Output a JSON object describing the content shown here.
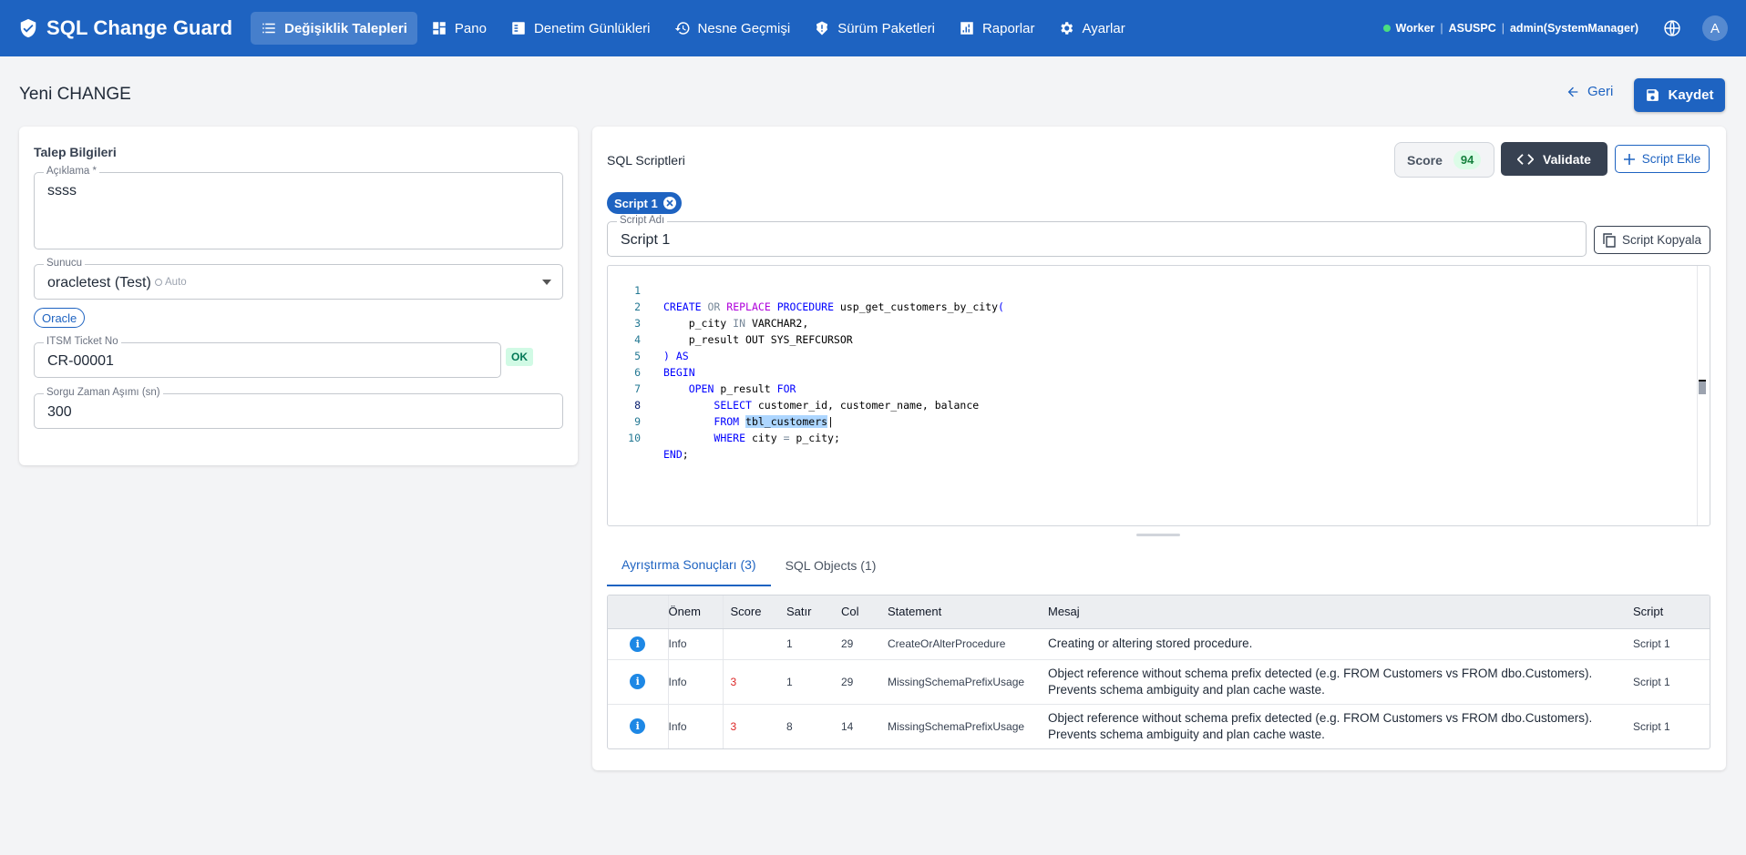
{
  "app": {
    "title": "SQL Change Guard"
  },
  "nav": {
    "items": [
      {
        "label": "Değişiklik Talepleri",
        "icon": "list-icon",
        "active": true
      },
      {
        "label": "Pano",
        "icon": "dashboard-icon"
      },
      {
        "label": "Denetim Günlükleri",
        "icon": "audit-log-icon"
      },
      {
        "label": "Nesne Geçmişi",
        "icon": "history-icon"
      },
      {
        "label": "Sürüm Paketleri",
        "icon": "package-icon"
      },
      {
        "label": "Raporlar",
        "icon": "bar-chart-icon"
      },
      {
        "label": "Ayarlar",
        "icon": "gear-icon"
      }
    ]
  },
  "topright": {
    "worker_label": "Worker",
    "host": "ASUSPC",
    "user": "admin(SystemManager)",
    "avatar_letter": "A",
    "worker_status_color": "#4ade80"
  },
  "page": {
    "title": "Yeni CHANGE",
    "back_label": "Geri",
    "save_label": "Kaydet"
  },
  "left": {
    "section_title": "Talep Bilgileri",
    "description": {
      "label": "Açıklama *",
      "value": "ssss"
    },
    "server": {
      "label": "Sunucu",
      "value": "oracletest (Test)",
      "auto_label": "Auto"
    },
    "db_chip": "Oracle",
    "ticket": {
      "label": "ITSM Ticket No",
      "value": "CR-00001",
      "status": "OK"
    },
    "timeout": {
      "label": "Sorgu Zaman Aşımı (sn)",
      "value": "300"
    }
  },
  "right": {
    "section_title": "SQL Scriptleri",
    "score_label": "Score",
    "score_value": "94",
    "validate_label": "Validate",
    "add_script_label": "Script Ekle",
    "script_tab_label": "Script 1",
    "script_name": {
      "label": "Script Adı",
      "value": "Script 1"
    },
    "copy_label": "Script Kopyala"
  },
  "editor": {
    "current_line": 8,
    "lines": [
      "CREATE OR REPLACE PROCEDURE usp_get_customers_by_city(",
      "    p_city IN VARCHAR2,",
      "    p_result OUT SYS_REFCURSOR",
      ") AS",
      "BEGIN",
      "    OPEN p_result FOR",
      "        SELECT customer_id, customer_name, balance",
      "        FROM tbl_customers",
      "        WHERE city = p_city;",
      "END;"
    ]
  },
  "tabs": [
    {
      "label": "Ayrıştırma Sonuçları (3)",
      "active": true
    },
    {
      "label": "SQL Objects (1)",
      "active": false
    }
  ],
  "results": {
    "columns": [
      "",
      "Önem",
      "Score",
      "Satır",
      "Col",
      "Statement",
      "Mesaj",
      "Script"
    ],
    "rows": [
      {
        "icon": "info-icon",
        "severity": "Info",
        "score": "",
        "line": "1",
        "col": "29",
        "statement": "CreateOrAlterProcedure",
        "message": "Creating or altering stored procedure.",
        "script": "Script 1"
      },
      {
        "icon": "info-icon",
        "severity": "Info",
        "score": "3",
        "line": "1",
        "col": "29",
        "statement": "MissingSchemaPrefixUsage",
        "message": "Object reference without schema prefix detected (e.g. FROM Customers vs FROM dbo.Customers). Prevents schema ambiguity and plan cache waste.",
        "script": "Script 1"
      },
      {
        "icon": "info-icon",
        "severity": "Info",
        "score": "3",
        "line": "8",
        "col": "14",
        "statement": "MissingSchemaPrefixUsage",
        "message": "Object reference without schema prefix detected (e.g. FROM Customers vs FROM dbo.Customers). Prevents schema ambiguity and plan cache waste.",
        "script": "Script 1"
      }
    ]
  },
  "colors": {
    "primary": "#1e63c1",
    "dark_button": "#374151",
    "score_badge_bg": "#dcfce7",
    "score_badge_fg": "#15803d",
    "warning_red": "#dc2626"
  }
}
